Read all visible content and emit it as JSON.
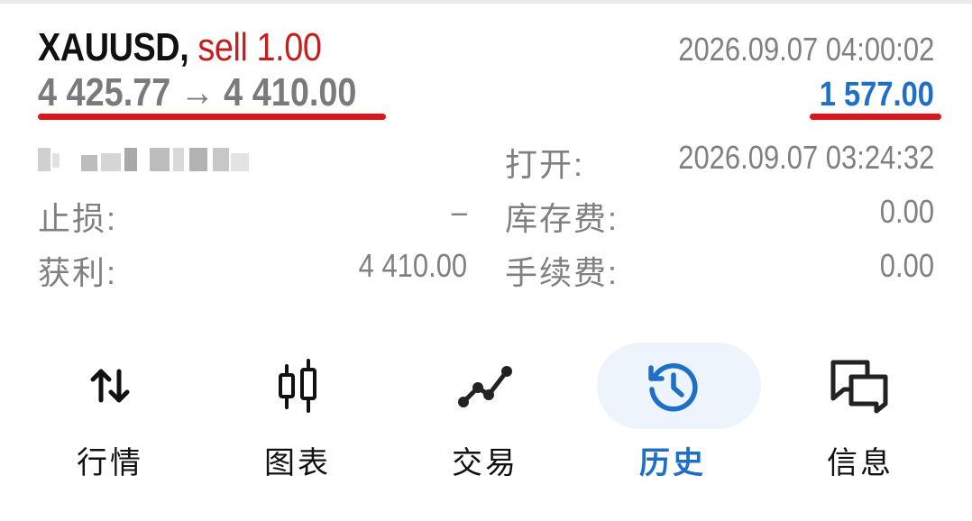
{
  "colors": {
    "accent": "#1f6fc7",
    "sell": "#c21f1f",
    "annotation": "#d7191c",
    "text_primary": "#111111",
    "text_secondary": "#808080"
  },
  "deal": {
    "symbol": "XAUUSD,",
    "side": "sell 1.00",
    "price_open": "4 425.77",
    "arrow": "→",
    "price_close": "4 410.00",
    "close_time": "2026.09.07 04:00:02",
    "profit": "1 577.00",
    "order_id_redacted": true,
    "open_label": "打开:",
    "open_time": "2026.09.07 03:24:32",
    "sl_label": "止损:",
    "sl_value": "–",
    "tp_label": "获利:",
    "tp_value": "4 410.00",
    "swap_label": "库存费:",
    "swap_value": "0.00",
    "commission_label": "手续费:",
    "commission_value": "0.00"
  },
  "nav": {
    "items": [
      {
        "label": "行情",
        "icon": "quotes-arrows-icon",
        "active": false
      },
      {
        "label": "图表",
        "icon": "candlestick-chart-icon",
        "active": false
      },
      {
        "label": "交易",
        "icon": "trade-line-icon",
        "active": false
      },
      {
        "label": "历史",
        "icon": "history-clock-icon",
        "active": true
      },
      {
        "label": "信息",
        "icon": "messages-icon",
        "active": false
      }
    ]
  }
}
